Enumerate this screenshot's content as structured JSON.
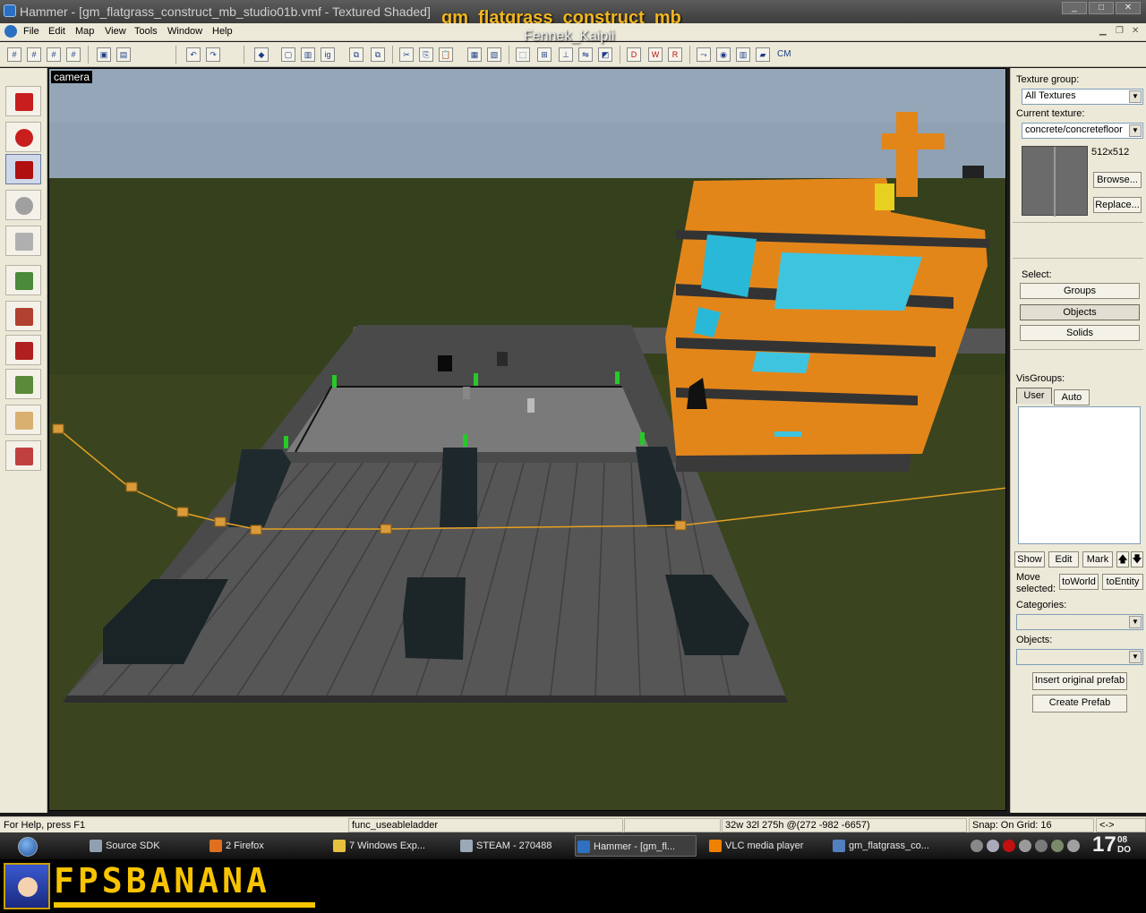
{
  "window": {
    "title": "Hammer - [gm_flatgrass_construct_mb_studio01b.vmf - Textured Shaded]",
    "overlay_title": "gm_flatgrass_construct_mb",
    "overlay_subtitle": "Fennek_Kaipii"
  },
  "menu": [
    "File",
    "Edit",
    "Map",
    "View",
    "Tools",
    "Window",
    "Help"
  ],
  "toolbar": {
    "cm_label": "CM"
  },
  "tools": [
    {
      "name": "selection-tool",
      "color": "#c81e1e"
    },
    {
      "name": "magnify-tool",
      "color": "#c81e1e"
    },
    {
      "name": "camera-tool",
      "color": "#b01010"
    },
    {
      "name": "entity-tool",
      "color": "#a0a0a0"
    },
    {
      "name": "block-tool",
      "color": "#b0b0b0"
    },
    {
      "name": "texture-application-tool",
      "color": "#4a8a3a"
    },
    {
      "name": "apply-current-texture-tool",
      "color": "#b04030"
    },
    {
      "name": "decal-tool",
      "color": "#b02020"
    },
    {
      "name": "overlay-tool",
      "color": "#5a8a3a"
    },
    {
      "name": "clipping-tool",
      "color": "#d9b070"
    },
    {
      "name": "vertex-manipulation-tool",
      "color": "#c04040"
    }
  ],
  "viewport": {
    "label": "camera"
  },
  "panel": {
    "texture_group_label": "Texture group:",
    "texture_group_value": "All Textures",
    "current_texture_label": "Current texture:",
    "current_texture_value": "concrete/concretefloor",
    "texture_size": "512x512",
    "browse": "Browse...",
    "replace": "Replace...",
    "select_label": "Select:",
    "groups": "Groups",
    "objects_btn": "Objects",
    "solids": "Solids",
    "visgroups_label": "VisGroups:",
    "tab_user": "User",
    "tab_auto": "Auto",
    "show": "Show",
    "edit": "Edit",
    "mark": "Mark",
    "up_arrow": "🡅",
    "down_arrow": "🡇",
    "move_selected_1": "Move",
    "move_selected_2": "selected:",
    "to_world": "toWorld",
    "to_entity": "toEntity",
    "categories_label": "Categories:",
    "objects_label": "Objects:",
    "insert_prefab": "Insert original prefab",
    "create_prefab": "Create Prefab"
  },
  "status": {
    "help": "For Help, press F1",
    "selection": "func_useableladder",
    "dimensions": "32w 32l 275h @(272 -982 -6657)",
    "snap": "Snap: On Grid: 16",
    "arrows": "<->"
  },
  "taskbar": {
    "tasks": [
      {
        "label": "Source SDK",
        "color": "#8fa0b0"
      },
      {
        "label": "2 Firefox",
        "color": "#e07020"
      },
      {
        "label": "7 Windows Exp...",
        "color": "#e8c040"
      },
      {
        "label": "STEAM - 270488",
        "color": "#9aa8b8"
      },
      {
        "label": "Hammer - [gm_fl...",
        "color": "#3070c0"
      },
      {
        "label": "VLC media player",
        "color": "#f08000"
      },
      {
        "label": "gm_flatgrass_co...",
        "color": "#5080c0"
      }
    ],
    "clock_hour": "17",
    "clock_min": "08",
    "clock_day": "DO"
  },
  "brand": {
    "logo": "FPSBANANA"
  }
}
